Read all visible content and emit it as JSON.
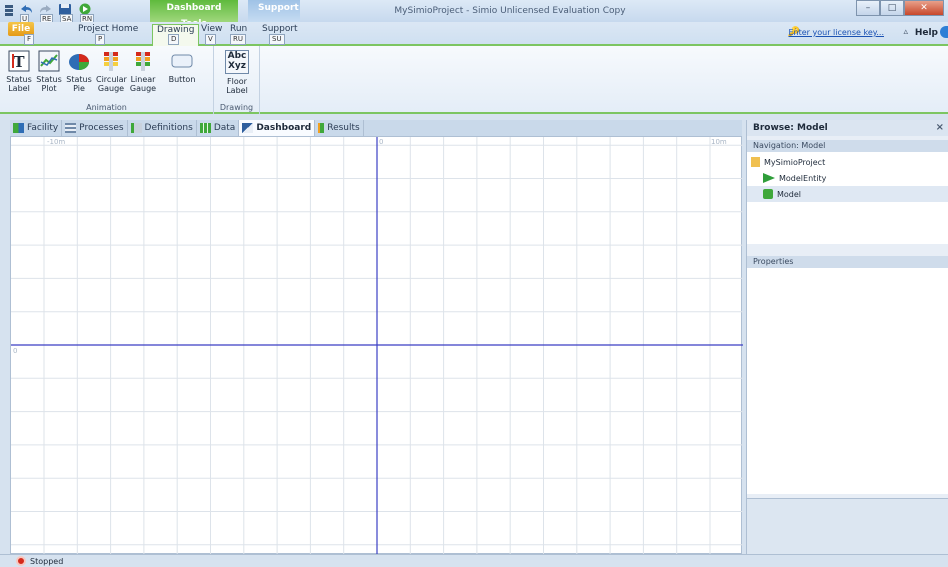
{
  "window": {
    "title": "MySimioProject - Simio Unlicensed Evaluation Copy",
    "contextual_tabs": [
      "Dashboard Tools",
      "Support"
    ],
    "quick_access_keytips": [
      "U",
      "RE",
      "SA",
      "RN"
    ]
  },
  "ribbon_tabs": [
    {
      "label": "File",
      "keytip": "F"
    },
    {
      "label": "Project Home",
      "keytip": "P"
    },
    {
      "label": "Drawing",
      "keytip": "D"
    },
    {
      "label": "View",
      "keytip": "V"
    },
    {
      "label": "Run",
      "keytip": "RU"
    },
    {
      "label": "Support",
      "keytip": "SU"
    }
  ],
  "license_link": "Enter your license key...",
  "help_label": "Help",
  "ribbon": {
    "animation_group": {
      "label": "Animation",
      "buttons": [
        {
          "line1": "Status",
          "line2": "Label",
          "icon": "status-label-icon"
        },
        {
          "line1": "Status",
          "line2": "Plot",
          "icon": "status-plot-icon"
        },
        {
          "line1": "Status",
          "line2": "Pie",
          "icon": "status-pie-icon"
        },
        {
          "line1": "Circular",
          "line2": "Gauge",
          "icon": "circular-gauge-icon"
        },
        {
          "line1": "Linear",
          "line2": "Gauge",
          "icon": "linear-gauge-icon"
        },
        {
          "line1": "Button",
          "line2": "",
          "icon": "button-icon"
        }
      ]
    },
    "drawing_group": {
      "label": "Drawing",
      "buttons": [
        {
          "line1": "Floor",
          "line2": "Label",
          "icon": "floor-label-icon"
        }
      ]
    },
    "floor_label_icon_text": [
      "Abc",
      "Xyz"
    ]
  },
  "doc_tabs": [
    "Facility",
    "Processes",
    "Definitions",
    "Data",
    "Dashboard",
    "Results"
  ],
  "active_doc_tab": "Dashboard",
  "canvas": {
    "axis_labels": [
      "-10m",
      "0",
      "10m",
      "0"
    ]
  },
  "browse": {
    "title": "Browse: Model",
    "close": "×",
    "navigation_header": "Navigation: Model",
    "nav_items": [
      {
        "label": "MySimioProject",
        "icon": "folder-icon"
      },
      {
        "label": "ModelEntity",
        "icon": "entity-triangle-icon"
      },
      {
        "label": "Model",
        "icon": "model-cube-icon"
      }
    ],
    "properties_header": "Properties"
  },
  "status": {
    "text": "Stopped"
  },
  "colors": {
    "accent_green": "#7cc561",
    "axis_blue": "#3b3fc4",
    "stop_red": "#d42a1c"
  }
}
